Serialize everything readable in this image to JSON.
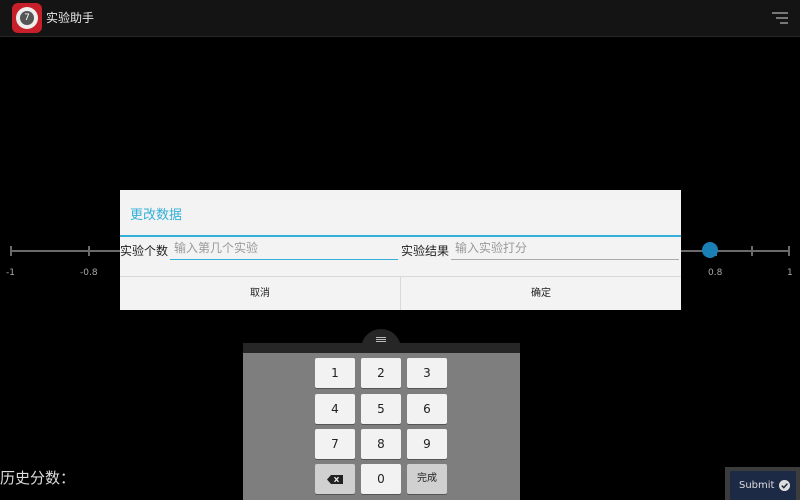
{
  "app": {
    "icon_badge": "7",
    "title": "实验助手"
  },
  "slider": {
    "ticks": [
      {
        "label": "-1"
      },
      {
        "label": "-0.8"
      },
      {
        "label": ""
      },
      {
        "label": ""
      },
      {
        "label": ""
      },
      {
        "label": ""
      },
      {
        "label": ""
      },
      {
        "label": ""
      },
      {
        "label": ""
      },
      {
        "label": "0.8"
      },
      {
        "label": "1"
      }
    ],
    "value": 0.8
  },
  "dialog": {
    "title": "更改数据",
    "field1_label": "实验个数",
    "field1_placeholder": "输入第几个实验",
    "field1_value": "",
    "field2_label": "实验结果",
    "field2_placeholder": "输入实验打分",
    "field2_value": "",
    "cancel_label": "取消",
    "ok_label": "确定",
    "accent_color": "#34b0d9"
  },
  "keyboard": {
    "keys": [
      "1",
      "2",
      "3",
      "4",
      "5",
      "6",
      "7",
      "8",
      "9",
      "0"
    ],
    "done_label": "完成"
  },
  "history_label": "历史分数：",
  "submit_label": "Submit"
}
